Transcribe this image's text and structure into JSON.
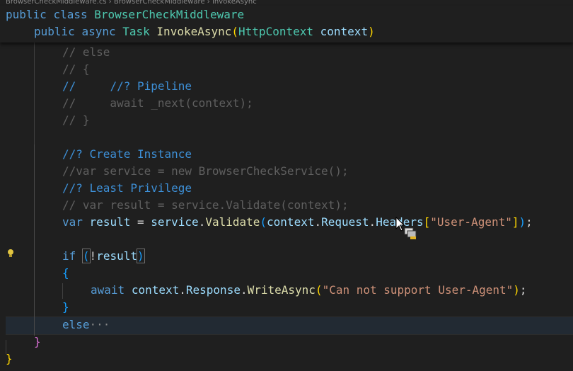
{
  "breadcrumb": {
    "file": "BrowserCheckMiddleware.cs",
    "class": "BrowserCheckMiddleware",
    "method": "InvokeAsync"
  },
  "sticky": {
    "line1": {
      "kw1": "public",
      "kw2": "class",
      "name": "BrowserCheckMiddleware"
    },
    "line2": {
      "kw1": "public",
      "kw2": "async",
      "type1": "Task",
      "fn": "InvokeAsync",
      "open": "(",
      "type2": "HttpContext",
      "param": "context",
      "close": ")"
    }
  },
  "code": {
    "l1": "// else",
    "l2": "// {",
    "l3_prefix": "//     ",
    "l3_comment": "//? Pipeline",
    "l4": "//     await _next(context);",
    "l5": "// }",
    "l7": "//? Create Instance",
    "l8": "//var service = new BrowserCheckService();",
    "l9": "//? Least Privilege",
    "l10": "// var result = service.Validate(context);",
    "l11": {
      "var": "var",
      "result": "result",
      "eq": " = ",
      "service": "service",
      "dot1": ".",
      "validate": "Validate",
      "open": "(",
      "context": "context",
      "dot2": ".",
      "request": "Request",
      "dot3": ".",
      "headers": "Headers",
      "lb": "[",
      "str": "\"User-Agent\"",
      "rb": "]",
      "close": ")",
      "semi": ";"
    },
    "l13": {
      "if": "if",
      "open": "(",
      "not": "!",
      "result": "result",
      "close": ")"
    },
    "l14": "{",
    "l15": {
      "await": "await",
      "context": "context",
      "dot1": ".",
      "response": "Response",
      "dot2": ".",
      "write": "WriteAsync",
      "open": "(",
      "str": "\"Can not support User-Agent\"",
      "close": ")",
      "semi": ";"
    },
    "l16": "}",
    "l17": {
      "else": "else",
      "ellipsis": "···"
    },
    "l18": "}",
    "l19": "}"
  },
  "colors": {
    "background": "#1f1f1f",
    "keyword": "#569cd6",
    "type": "#4ec9b0",
    "function": "#dcdcaa",
    "variable": "#9cdcfe",
    "string": "#ce9178"
  },
  "icons": {
    "bulb": "lightbulb-icon",
    "cursor": "mouse-pointer-copy-icon"
  }
}
